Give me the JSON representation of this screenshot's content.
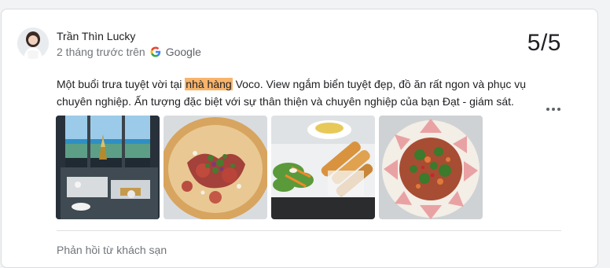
{
  "review": {
    "reviewer_name": "Trần Thìn Lucky",
    "time_text": "2 tháng trước trên",
    "source_name": "Google",
    "rating_text": "5/5",
    "text_before": "Một buổi trưa tuyệt vời tại ",
    "text_highlight": "nhà hàng",
    "text_after": " Voco. View ngắm biển tuyệt đẹp, đồ ăn rất ngon và phục vụ chuyên nghiệp. Ấn tượng đặc biệt với sự thân thiện và chuyên nghiệp của bạn Đạt - giám sát.",
    "highlight_color": "#f8b46b",
    "more_icon": "more-horiz-icon",
    "photos": [
      {
        "icon": "photo-restaurant-sea-view"
      },
      {
        "icon": "photo-pizza"
      },
      {
        "icon": "photo-spring-rolls-salad"
      },
      {
        "icon": "photo-salad-plate"
      }
    ]
  },
  "reply": {
    "label": "Phản hồi từ khách sạn"
  },
  "colors": {
    "text_primary": "#202124",
    "text_secondary": "#70757a",
    "border": "#dadce0"
  }
}
